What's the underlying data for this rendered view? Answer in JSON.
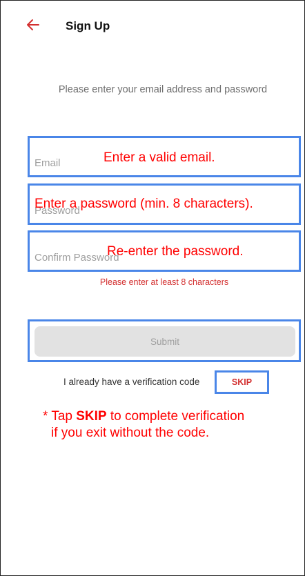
{
  "header": {
    "title": "Sign Up",
    "back_icon": "arrow-left-icon",
    "accent_color": "#d32f2f"
  },
  "form": {
    "subtitle": "Please enter your email address and password",
    "email_placeholder": "Email",
    "password_placeholder": "Password",
    "confirm_placeholder": "Confirm Password",
    "error_text": "Please enter at least 8 characters",
    "submit_label": "Submit"
  },
  "verification": {
    "code_text": "I already have a verification code",
    "skip_label": "SKIP"
  },
  "annotations": {
    "email_hint": "Enter a valid email.",
    "password_hint": "Enter a password (min. 8 characters).",
    "confirm_hint": "Re-enter the password.",
    "note_prefix": "* Tap ",
    "note_bold": "SKIP",
    "note_suffix": " to complete verification",
    "note_line2": "if you exit without the code.",
    "highlight_color": "#4a86e8",
    "annotation_color": "#ff0000"
  }
}
